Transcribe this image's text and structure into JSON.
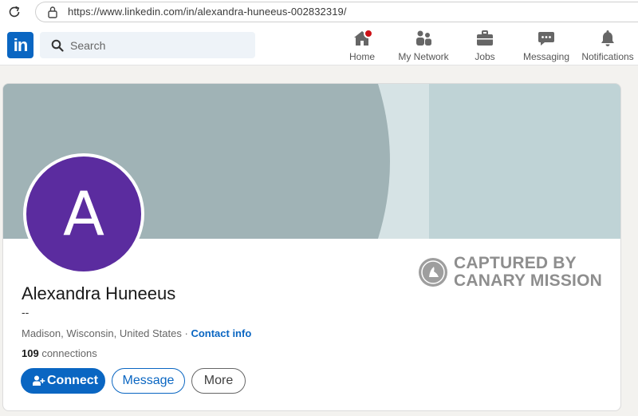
{
  "browser": {
    "url": "https://www.linkedin.com/in/alexandra-huneeus-002832319/"
  },
  "nav": {
    "logo_text": "in",
    "search_placeholder": "Search",
    "items": [
      {
        "label": "Home",
        "icon": "home-icon"
      },
      {
        "label": "My Network",
        "icon": "network-icon"
      },
      {
        "label": "Jobs",
        "icon": "briefcase-icon"
      },
      {
        "label": "Messaging",
        "icon": "messaging-icon"
      },
      {
        "label": "Notifications",
        "icon": "bell-icon"
      }
    ]
  },
  "profile": {
    "avatar_letter": "A",
    "name": "Alexandra Huneeus",
    "headline": "--",
    "location": "Madison, Wisconsin, United States",
    "separator": " · ",
    "contact_info": "Contact info",
    "connections_count": "109",
    "connections_label": " connections"
  },
  "actions": {
    "connect": "Connect",
    "message": "Message",
    "more": "More"
  },
  "watermark": {
    "line1": "CAPTURED BY",
    "line2": "CANARY MISSION"
  },
  "colors": {
    "brand": "#0a66c2",
    "avatar": "#5b2c9f",
    "badge": "#cc1016"
  }
}
